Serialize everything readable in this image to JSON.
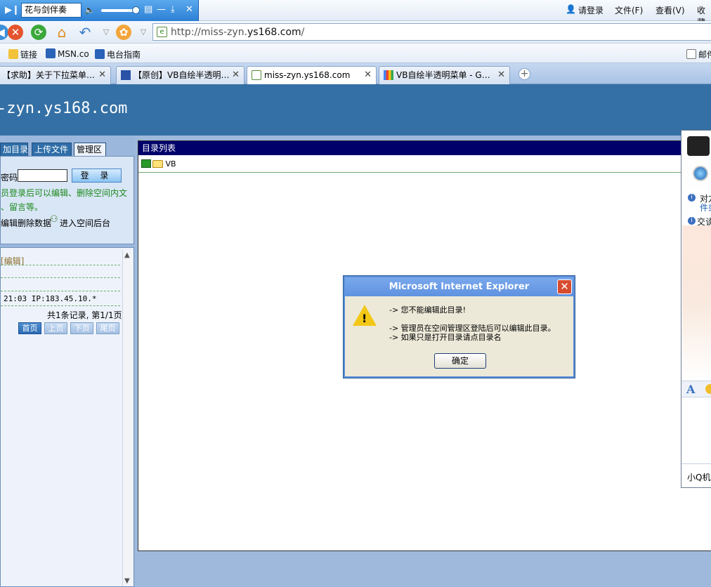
{
  "media_bar": {
    "song": "花与剑伴奏"
  },
  "menu": {
    "login": "请登录",
    "file": "文件(F)",
    "view": "查看(V)",
    "favorites": "收藏"
  },
  "address": {
    "url_prefix": "http://miss-zyn.",
    "url_domain": "ys168.com",
    "url_suffix": "/"
  },
  "favorites_bar": {
    "links": "链接",
    "msn": "MSN.co",
    "radio": "电台指南",
    "mail": "邮件"
  },
  "tabs": [
    {
      "label": "【求助】关于下拉菜单…"
    },
    {
      "label": "【原创】VB自绘半透明…"
    },
    {
      "label": "miss-zyn.ys168.com"
    },
    {
      "label": "VB自绘半透明菜单 - G…"
    }
  ],
  "site": {
    "title": "-zyn.ys168.com"
  },
  "left_tabs": {
    "add_dir": "加目录",
    "upload": "上传文件",
    "manage": "管理区"
  },
  "login": {
    "password_label": "密码:",
    "login_button": "登 录",
    "tip_line1": "员登录后可以编辑、删除空间内文",
    "tip_line2": "、留言等。",
    "edit_delete": "编辑删除数据",
    "enter_backend": "进入空间后台"
  },
  "messages": {
    "edit_link": "[编辑]",
    "ip_line": "21:03 IP:183.45.10.*",
    "total": "共1条记录, 第1/1页",
    "pager": {
      "first": "首页",
      "prev": "上页",
      "next": "下页",
      "last": "尾页"
    }
  },
  "dir_list": {
    "header": "目录列表",
    "folder": "VB"
  },
  "dialog": {
    "title": "Microsoft Internet Explorer",
    "line1": "-> 您不能编辑此目录!",
    "line2": "-> 管理员在空间管理区登陆后可以编辑此目录。",
    "line3": "-> 如果只是打开目录请点目录名",
    "ok": "确定"
  },
  "qq_panel": {
    "line1": "对方",
    "line2": "件或",
    "line3": "交谈",
    "footer": "小Q机"
  }
}
